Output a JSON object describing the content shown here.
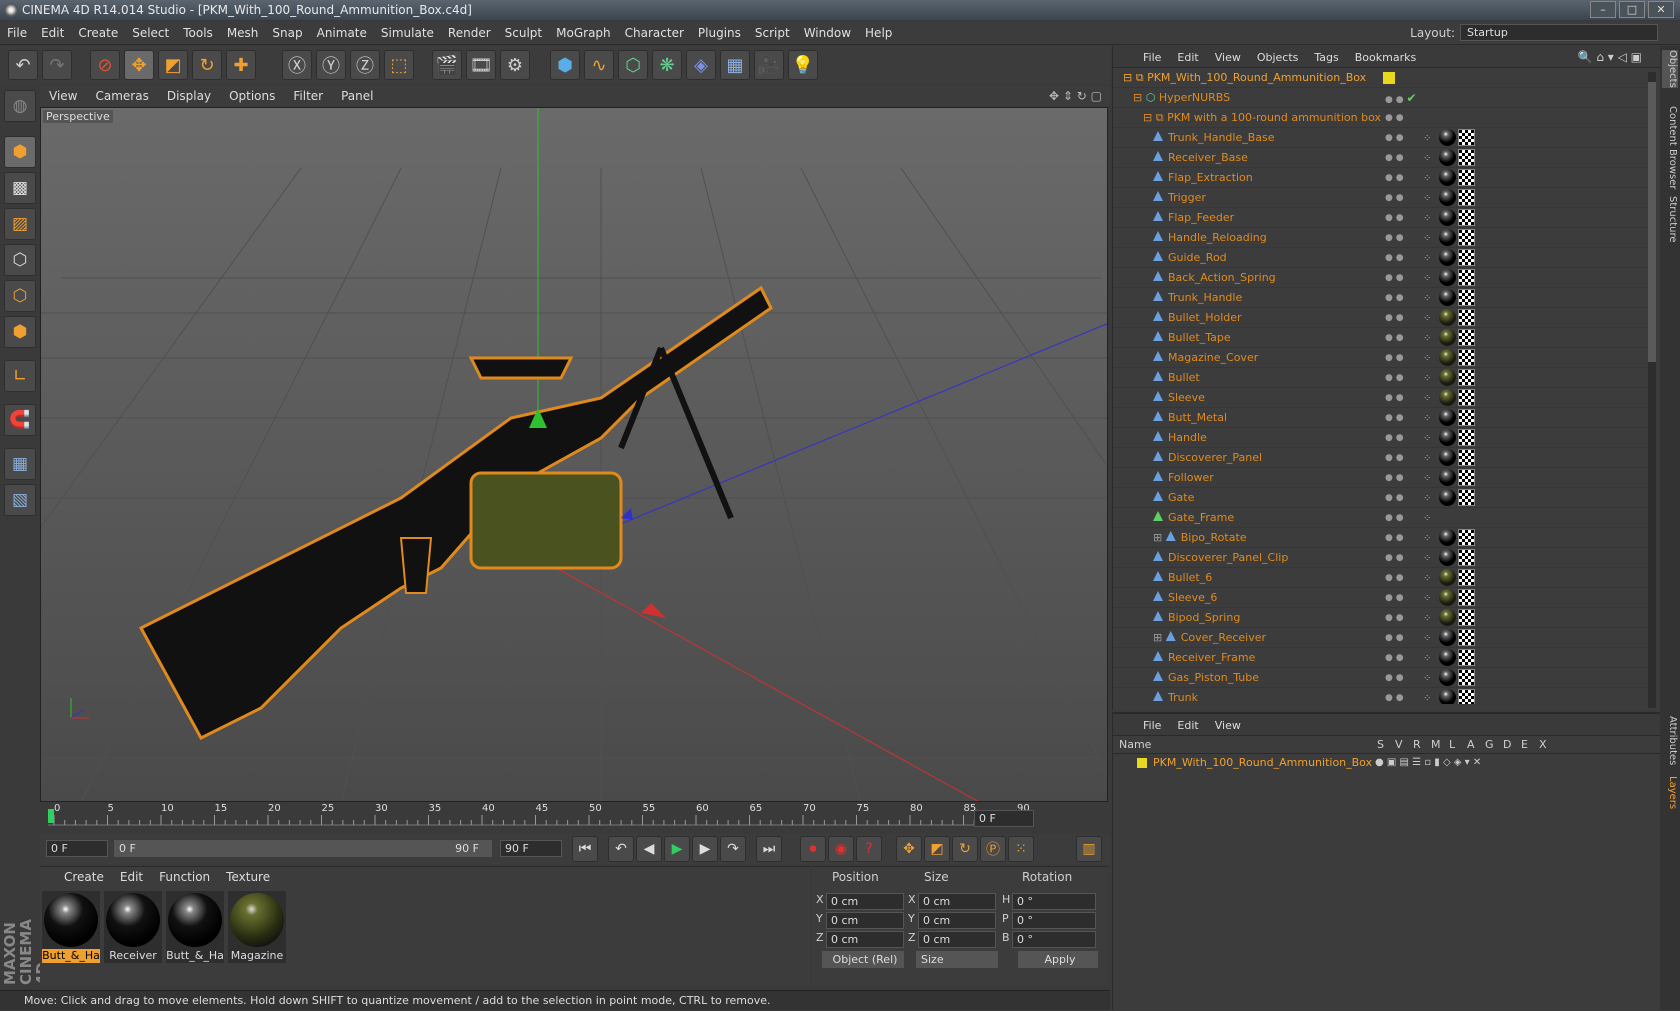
{
  "window": {
    "title": "CINEMA 4D R14.014 Studio - [PKM_With_100_Round_Ammunition_Box.c4d]"
  },
  "menu": [
    "File",
    "Edit",
    "Create",
    "Select",
    "Tools",
    "Mesh",
    "Snap",
    "Animate",
    "Simulate",
    "Render",
    "Sculpt",
    "MoGraph",
    "Character",
    "Plugins",
    "Script",
    "Window",
    "Help"
  ],
  "layout": {
    "label": "Layout:",
    "value": "Startup"
  },
  "viewport": {
    "menu": [
      "View",
      "Cameras",
      "Display",
      "Options",
      "Filter",
      "Panel"
    ],
    "label": "Perspective"
  },
  "timeline": {
    "ticks": [
      "0",
      "5",
      "10",
      "15",
      "20",
      "25",
      "30",
      "35",
      "40",
      "45",
      "50",
      "55",
      "60",
      "65",
      "70",
      "75",
      "80",
      "85",
      "90"
    ],
    "current_frame": "0 F",
    "start_field": "0 F",
    "range_start": "0 F",
    "range_end": "90 F",
    "end_field": "90 F"
  },
  "materials": {
    "menu": [
      "Create",
      "Edit",
      "Function",
      "Texture"
    ],
    "items": [
      "Butt_&_Ha",
      "Receiver",
      "Butt_&_Ha",
      "Magazine"
    ]
  },
  "coords": {
    "headers": [
      "Position",
      "Size",
      "Rotation"
    ],
    "rows": [
      {
        "axis": "X",
        "pos": "0 cm",
        "saxis": "X",
        "size": "0 cm",
        "raxis": "H",
        "rot": "0 °"
      },
      {
        "axis": "Y",
        "pos": "0 cm",
        "saxis": "Y",
        "size": "0 cm",
        "raxis": "P",
        "rot": "0 °"
      },
      {
        "axis": "Z",
        "pos": "0 cm",
        "saxis": "Z",
        "size": "0 cm",
        "raxis": "B",
        "rot": "0 °"
      }
    ],
    "mode": "Object (Rel)",
    "size_mode": "Size",
    "apply": "Apply"
  },
  "status": "Move: Click and drag to move elements. Hold down SHIFT to quantize movement / add to the selection in point mode, CTRL to remove.",
  "objects": {
    "menu": [
      "File",
      "Edit",
      "View",
      "Objects",
      "Tags",
      "Bookmarks"
    ],
    "root": "PKM_With_100_Round_Ammunition_Box",
    "hypernurbs": "HyperNURBS",
    "group": "PKM with a 100-round ammunition box",
    "items": [
      "Trunk_Handle_Base",
      "Receiver_Base",
      "Flap_Extraction",
      "Trigger",
      "Flap_Feeder",
      "Handle_Reloading",
      "Guide_Rod",
      "Back_Action_Spring",
      "Trunk_Handle",
      "Bullet_Holder",
      "Bullet_Tape",
      "Magazine_Cover",
      "Bullet",
      "Sleeve",
      "Butt_Metal",
      "Handle",
      "Discoverer_Panel",
      "Follower",
      "Gate",
      "Gate_Frame",
      "Bipo_Rotate",
      "Discoverer_Panel_Clip",
      "Bullet_6",
      "Sleeve_6",
      "Bipod_Spring",
      "Cover_Receiver",
      "Receiver_Frame",
      "Gas_Piston_Tube",
      "Trunk"
    ]
  },
  "layers": {
    "menu": [
      "File",
      "Edit",
      "View"
    ],
    "columns": [
      "Name",
      "S",
      "V",
      "R",
      "M",
      "L",
      "A",
      "G",
      "D",
      "E",
      "X"
    ],
    "row": "PKM_With_100_Round_Ammunition_Box"
  },
  "sidetabs": [
    "Objects",
    "Content Browser",
    "Structure",
    "Attributes",
    "Layers"
  ],
  "brand": "MAXON CINEMA 4D",
  "colors": {
    "accent": "#e08a1e",
    "selection_orange": "#f0a030",
    "viewport_bg": "#5a5a5a"
  }
}
